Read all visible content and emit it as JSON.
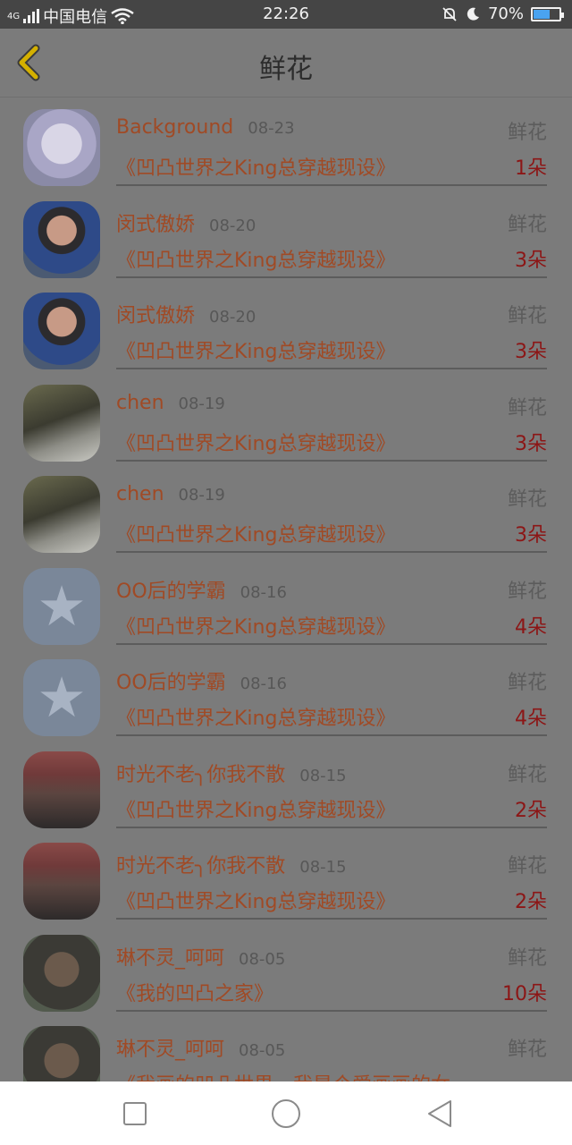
{
  "status_bar": {
    "network_badge": "4G",
    "carrier": "中国电信",
    "time": "22:26",
    "battery": "70%",
    "battery_level": 0.7
  },
  "header": {
    "title": "鲜花"
  },
  "rows": [
    {
      "name": "Background",
      "date": "08-23",
      "type": "鲜花",
      "book": "《凹凸世界之King总穿越现设》",
      "count": "1朵",
      "avatar": "anime-avatar"
    },
    {
      "name": "闵式傲娇",
      "date": "08-20",
      "type": "鲜花",
      "book": "《凹凸世界之King总穿越现设》",
      "count": "3朵",
      "avatar": "man-avatar"
    },
    {
      "name": "闵式傲娇",
      "date": "08-20",
      "type": "鲜花",
      "book": "《凹凸世界之King总穿越现设》",
      "count": "3朵",
      "avatar": "man-avatar"
    },
    {
      "name": "chen",
      "date": "08-19",
      "type": "鲜花",
      "book": "《凹凸世界之King总穿越现设》",
      "count": "3朵",
      "avatar": "girl-avatar"
    },
    {
      "name": "chen",
      "date": "08-19",
      "type": "鲜花",
      "book": "《凹凸世界之King总穿越现设》",
      "count": "3朵",
      "avatar": "girl-avatar"
    },
    {
      "name": "OO后的学霸",
      "date": "08-16",
      "type": "鲜花",
      "book": "《凹凸世界之King总穿越现设》",
      "count": "4朵",
      "avatar": "qq-avatar"
    },
    {
      "name": "OO后的学霸",
      "date": "08-16",
      "type": "鲜花",
      "book": "《凹凸世界之King总穿越现设》",
      "count": "4朵",
      "avatar": "qq-avatar"
    },
    {
      "name": "时光不老╮你我不散",
      "date": "08-15",
      "type": "鲜花",
      "book": "《凹凸世界之King总穿越现设》",
      "count": "2朵",
      "avatar": "city-avatar"
    },
    {
      "name": "时光不老╮你我不散",
      "date": "08-15",
      "type": "鲜花",
      "book": "《凹凸世界之King总穿越现设》",
      "count": "2朵",
      "avatar": "city-avatar"
    },
    {
      "name": "琳不灵_呵呵",
      "date": "08-05",
      "type": "鲜花",
      "book": "《我的凹凸之家》",
      "count": "10朵",
      "avatar": "anime2-avatar"
    },
    {
      "name": "琳不灵_呵呵",
      "date": "08-05",
      "type": "鲜花",
      "book": "《我画的凹凸世界，我是个爱画画的女",
      "count": "",
      "avatar": "anime2-avatar"
    }
  ],
  "icons": {
    "back": "chevron-left-icon",
    "wifi": "wifi-icon",
    "mute": "bell-off-icon",
    "night": "moon-icon",
    "nav_recent": "square-icon",
    "nav_home": "circle-icon",
    "nav_back": "triangle-back-icon"
  },
  "colors": {
    "accent_name": "#a04a25",
    "count": "#8c1616",
    "back_arrow": "#d4b000"
  }
}
